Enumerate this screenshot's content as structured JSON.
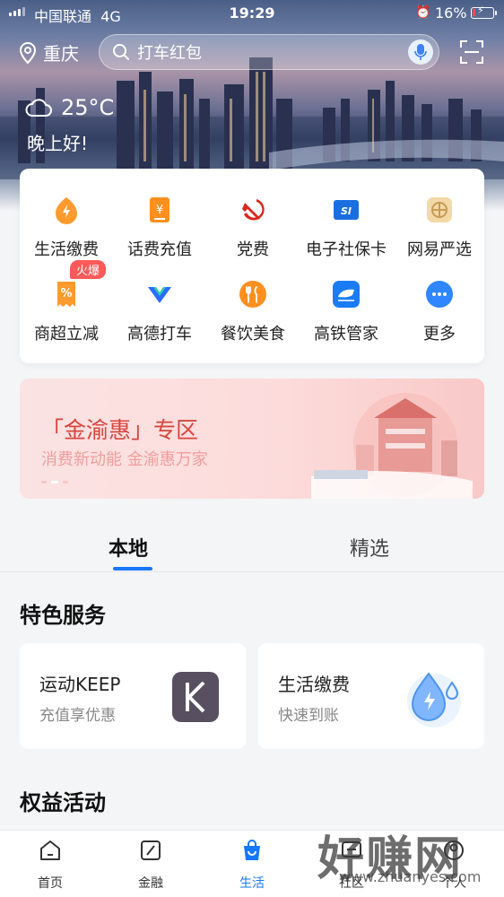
{
  "status_bar": {
    "carrier": "中国联通",
    "network": "4G",
    "time": "19:29",
    "battery": "16%",
    "battery_level": 0.16
  },
  "header": {
    "city": "重庆",
    "search_placeholder": "打车红包",
    "temperature": "25°C",
    "greeting": "晚上好!"
  },
  "services": [
    {
      "label": "生活缴费",
      "icon": "lightning-icon",
      "color": "#ff9a2e"
    },
    {
      "label": "话费充值",
      "icon": "yen-phone-icon",
      "color": "#ff8f1f"
    },
    {
      "label": "党费",
      "icon": "party-emblem-icon",
      "color": "#d8281f"
    },
    {
      "label": "电子社保卡",
      "icon": "social-security-card-icon",
      "color": "#1a6fe0"
    },
    {
      "label": "网易严选",
      "icon": "netease-yanxuan-icon",
      "color": "#e9c27a"
    },
    {
      "label": "商超立减",
      "icon": "discount-coupon-icon",
      "color": "#ff9a2e"
    },
    {
      "label": "高德打车",
      "icon": "amap-taxi-icon",
      "color": "#2c6bff"
    },
    {
      "label": "餐饮美食",
      "icon": "fork-knife-icon",
      "color": "#ff8f1f"
    },
    {
      "label": "高铁管家",
      "icon": "train-icon",
      "color": "#1a7cf5"
    },
    {
      "label": "更多",
      "icon": "more-dots-icon",
      "color": "#2f86ff"
    }
  ],
  "hot_badge": "火爆",
  "banner": {
    "title": "「金渝惠」专区",
    "subtitle": "消费新动能 金渝惠万家"
  },
  "tabs": [
    "本地",
    "精选"
  ],
  "featured": {
    "title": "特色服务",
    "items": [
      {
        "title": "运动KEEP",
        "subtitle": "充值享优惠",
        "icon": "keep-logo-icon"
      },
      {
        "title": "生活缴费",
        "subtitle": "快速到账",
        "icon": "water-drop-bolt-icon"
      }
    ]
  },
  "benefits_title": "权益活动",
  "bottom_nav": [
    {
      "label": "首页",
      "icon": "home-icon"
    },
    {
      "label": "金融",
      "icon": "finance-icon"
    },
    {
      "label": "生活",
      "icon": "shopping-bag-icon"
    },
    {
      "label": "社区",
      "icon": "community-icon"
    },
    {
      "label": "个人",
      "icon": "person-icon"
    }
  ],
  "watermark": {
    "text": "好赚网",
    "url": "www.zhuanyes.com"
  }
}
